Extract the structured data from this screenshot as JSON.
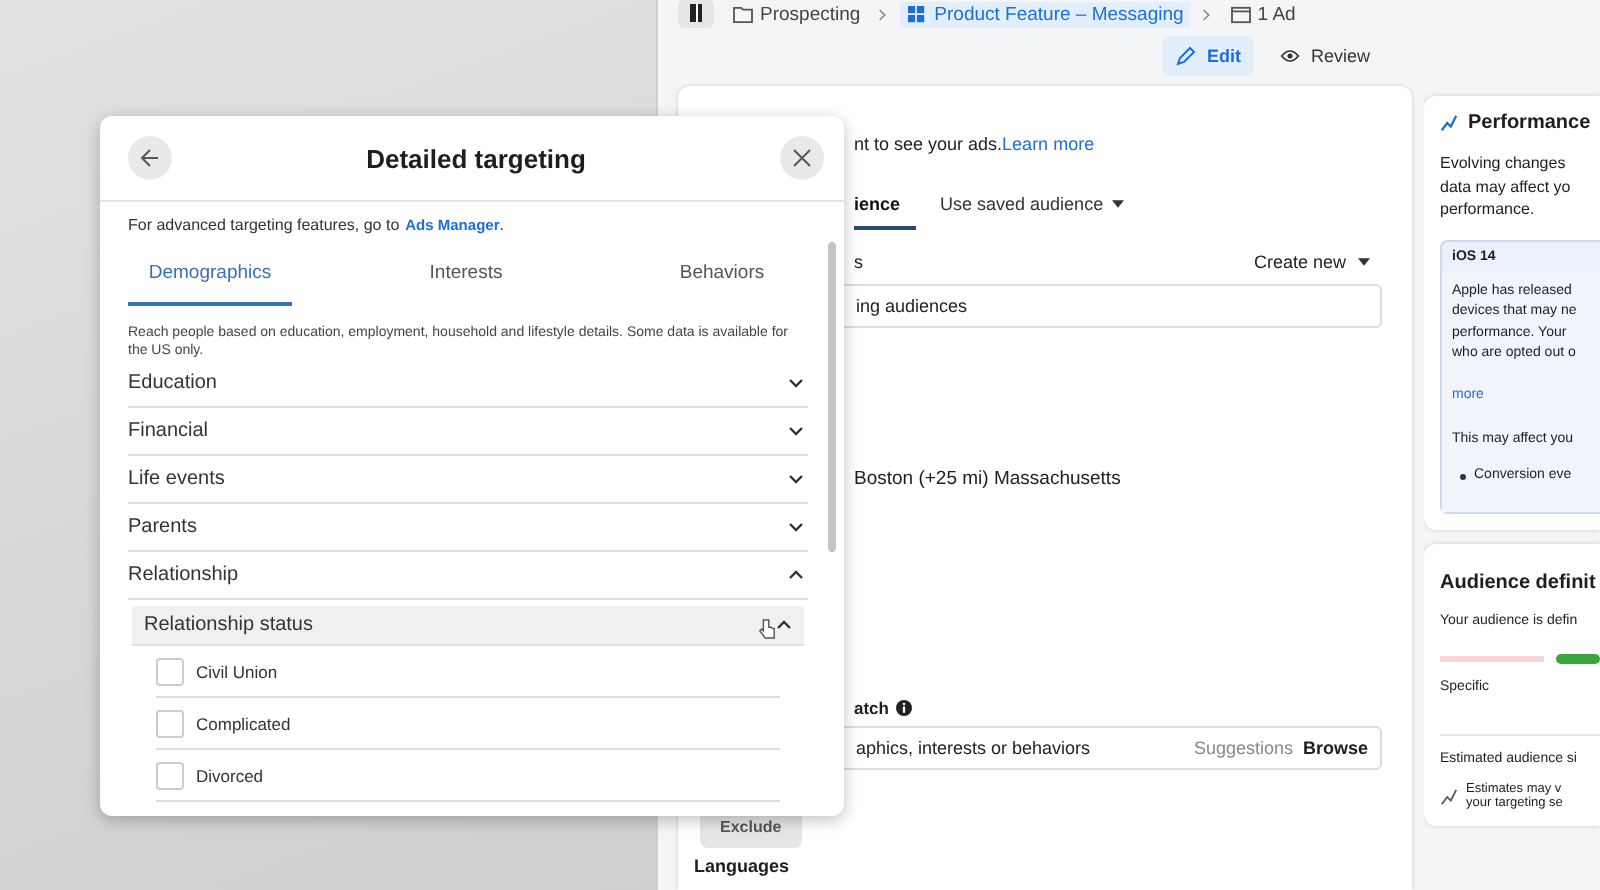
{
  "breadcrumb": [
    {
      "kind": "folder",
      "label": "Prospecting",
      "selected": false
    },
    {
      "kind": "grid",
      "label": "Product Feature – Messaging",
      "selected": true
    },
    {
      "kind": "ad",
      "label": "1 Ad",
      "selected": false
    }
  ],
  "mode_tabs": [
    {
      "kind": "edit",
      "label": "Edit",
      "selected": true
    },
    {
      "kind": "review",
      "label": "Review",
      "selected": false
    }
  ],
  "audience_card": {
    "intro": "nt to see your ads.",
    "intro_link": "Learn more",
    "tabs": [
      {
        "label": "ience",
        "selected": true,
        "dropdown": false
      },
      {
        "label": "Use saved audience",
        "selected": false,
        "dropdown": true
      }
    ],
    "section_label": "s",
    "create_new": "Create new",
    "saved_field": "ing audiences",
    "location": "Boston (+25 mi) Massachusetts",
    "match_label": "atch",
    "targeting_field": "aphics, interests or behaviors",
    "suggestions": "Suggestions",
    "browse": "Browse",
    "exclude": "Exclude",
    "languages": "Languages"
  },
  "performance_card": {
    "title": "Performance",
    "text": "Evolving changes\ndata may affect yo\nperformance.",
    "notice": {
      "title": "iOS 14",
      "text": "Apple has released\ndevices that may ne\nperformance. Your\nwho are opted out o",
      "link": "more",
      "text2": "This may affect you",
      "bullet": "Conversion eve"
    }
  },
  "definition_card": {
    "title": "Audience definit",
    "text": "Your audience is defin",
    "scale_label": "Specific",
    "estimated": "Estimated audience si",
    "estimate_note": "Estimates may v\nyour targeting se"
  },
  "targeting_dialog": {
    "title": "Detailed targeting",
    "hint": "For advanced targeting features, go to",
    "hint_link": "Ads Manager",
    "hint_end": ".",
    "tabs": [
      {
        "label": "Demographics",
        "selected": true
      },
      {
        "label": "Interests",
        "selected": false
      },
      {
        "label": "Behaviors",
        "selected": false
      }
    ],
    "description": "Reach people based on education, employment, household and lifestyle details. Some data is available for the US only.",
    "categories": [
      {
        "label": "Education",
        "expanded": false
      },
      {
        "label": "Financial",
        "expanded": false
      },
      {
        "label": "Life events",
        "expanded": false
      },
      {
        "label": "Parents",
        "expanded": false
      },
      {
        "label": "Relationship",
        "expanded": true,
        "children": [
          {
            "label": "Relationship status",
            "expanded": true,
            "children": [
              {
                "label": "Civil Union",
                "checked": false
              },
              {
                "label": "Complicated",
                "checked": false
              },
              {
                "label": "Divorced",
                "checked": false
              }
            ]
          }
        ]
      }
    ]
  }
}
